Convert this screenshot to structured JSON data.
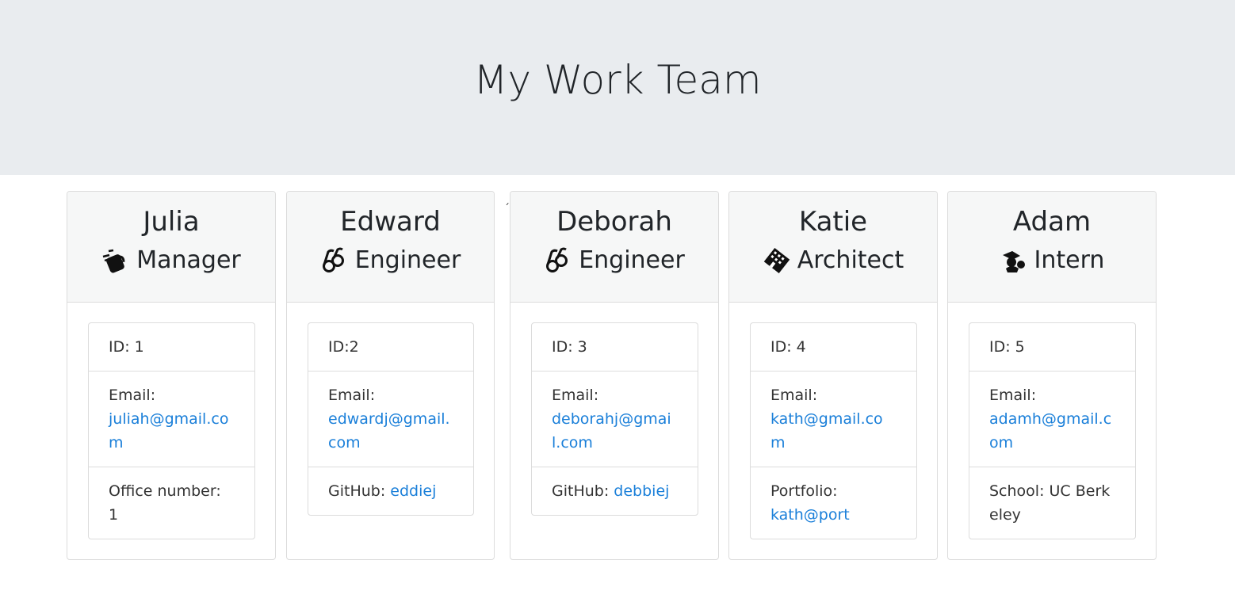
{
  "header": {
    "title": "My Work Team"
  },
  "cards": [
    {
      "name": "Julia",
      "role": "Manager",
      "role_icon": "mug-hot-icon",
      "id_text": "ID: 1",
      "email_label": "Email:",
      "email": "juliah@gmail.com",
      "extra_label": "Office number: 1",
      "extra_value": ""
    },
    {
      "name": "Edward",
      "role": "Engineer",
      "role_icon": "glasses-icon",
      "id_text": "ID:2",
      "email_label": "Email:",
      "email": "edwardj@gmail.com",
      "extra_label": "GitHub:",
      "extra_value": "eddiej"
    },
    {
      "name": "Deborah",
      "role": "Engineer",
      "role_icon": "glasses-icon",
      "id_text": "ID: 3",
      "email_label": "Email:",
      "email": "deborahj@gmail.com",
      "extra_label": "GitHub:",
      "extra_value": "debbiej"
    },
    {
      "name": "Katie",
      "role": "Architect",
      "role_icon": "building-icon",
      "id_text": "ID: 4",
      "email_label": "Email:",
      "email": "kath@gmail.com",
      "extra_label": "Portfolio:",
      "extra_value": "kath@port"
    },
    {
      "name": "Adam",
      "role": "Intern",
      "role_icon": "user-graduate-icon",
      "id_text": "ID: 5",
      "email_label": "Email:",
      "email": "adamh@gmail.com",
      "extra_label": "School: UC Berkeley",
      "extra_value": ""
    }
  ],
  "stray_mark": "´",
  "colors": {
    "link": "#1a7fd9",
    "jumbotron": "#e9ecef",
    "card_header": "#f6f7f7"
  }
}
